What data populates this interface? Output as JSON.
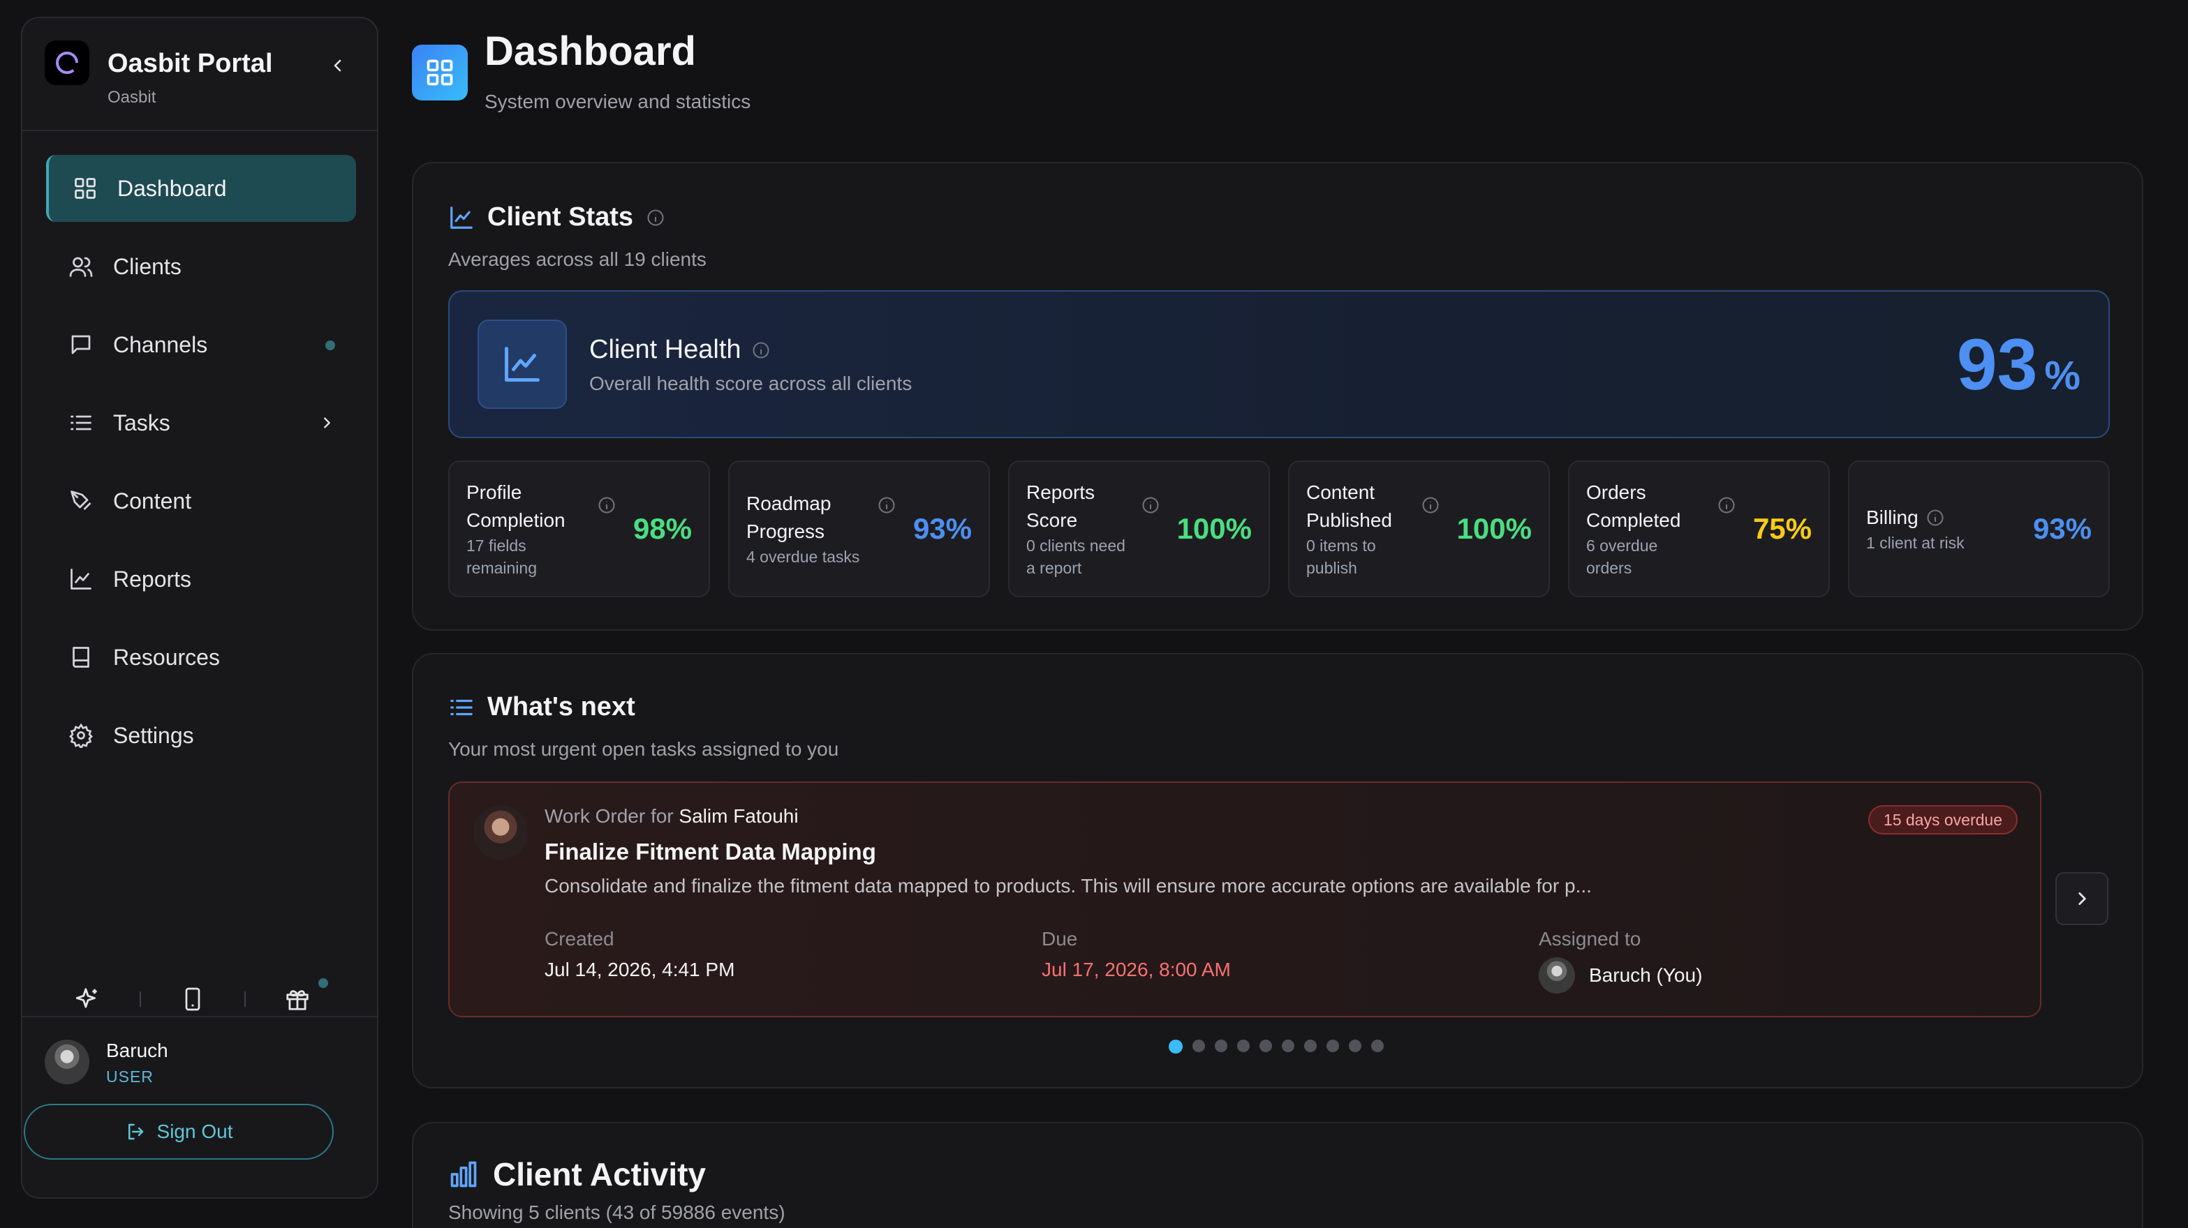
{
  "sidebar": {
    "app_title": "Oasbit Portal",
    "app_subtitle": "Oasbit",
    "items": [
      {
        "label": "Dashboard",
        "icon": "dashboard-icon",
        "active": true
      },
      {
        "label": "Clients",
        "icon": "users-icon"
      },
      {
        "label": "Channels",
        "icon": "chat-icon",
        "badge_dot": true
      },
      {
        "label": "Tasks",
        "icon": "list-icon",
        "has_submenu": true
      },
      {
        "label": "Content",
        "icon": "pen-icon"
      },
      {
        "label": "Reports",
        "icon": "chart-line-icon"
      },
      {
        "label": "Resources",
        "icon": "book-icon"
      },
      {
        "label": "Settings",
        "icon": "gear-icon"
      }
    ],
    "user": {
      "name": "Baruch",
      "role": "USER"
    },
    "sign_out_label": "Sign Out"
  },
  "header": {
    "title": "Dashboard",
    "subtitle": "System overview and statistics"
  },
  "client_stats": {
    "title": "Client Stats",
    "subtitle": "Averages across all 19 clients",
    "health": {
      "title": "Client Health",
      "subtitle": "Overall health score across all clients",
      "value": "93",
      "unit": "%"
    },
    "cards": [
      {
        "label": "Profile Completion",
        "sub": "17 fields remaining",
        "value": "98%",
        "color": "#4ade80"
      },
      {
        "label": "Roadmap Progress",
        "sub": "4 overdue tasks",
        "value": "93%",
        "color": "#4d8ff2"
      },
      {
        "label": "Reports Score",
        "sub": "0 clients need a report",
        "value": "100%",
        "color": "#4ade80"
      },
      {
        "label": "Content Published",
        "sub": "0 items to publish",
        "value": "100%",
        "color": "#4ade80"
      },
      {
        "label": "Orders Completed",
        "sub": "6 overdue orders",
        "value": "75%",
        "color": "#facc15"
      },
      {
        "label": "Billing",
        "sub": "1 client at risk",
        "value": "93%",
        "color": "#4d8ff2"
      }
    ]
  },
  "whats_next": {
    "title": "What's next",
    "subtitle": "Your most urgent open tasks assigned to you",
    "task": {
      "prefix": "Work Order for",
      "client": "Salim Fatouhi",
      "title": "Finalize Fitment Data Mapping",
      "description": "Consolidate and finalize the fitment data mapped to products. This will ensure more accurate options are available for p...",
      "badge": "15 days overdue",
      "created_label": "Created",
      "created_value": "Jul 14, 2026, 4:41 PM",
      "due_label": "Due",
      "due_value": "Jul 17, 2026, 8:00 AM",
      "assigned_label": "Assigned to",
      "assigned_value": "Baruch (You)"
    },
    "pagination": {
      "total": 10,
      "current": 1
    }
  },
  "client_activity": {
    "title": "Client Activity",
    "subtitle": "Showing 5 clients (43 of 59886 events)"
  }
}
